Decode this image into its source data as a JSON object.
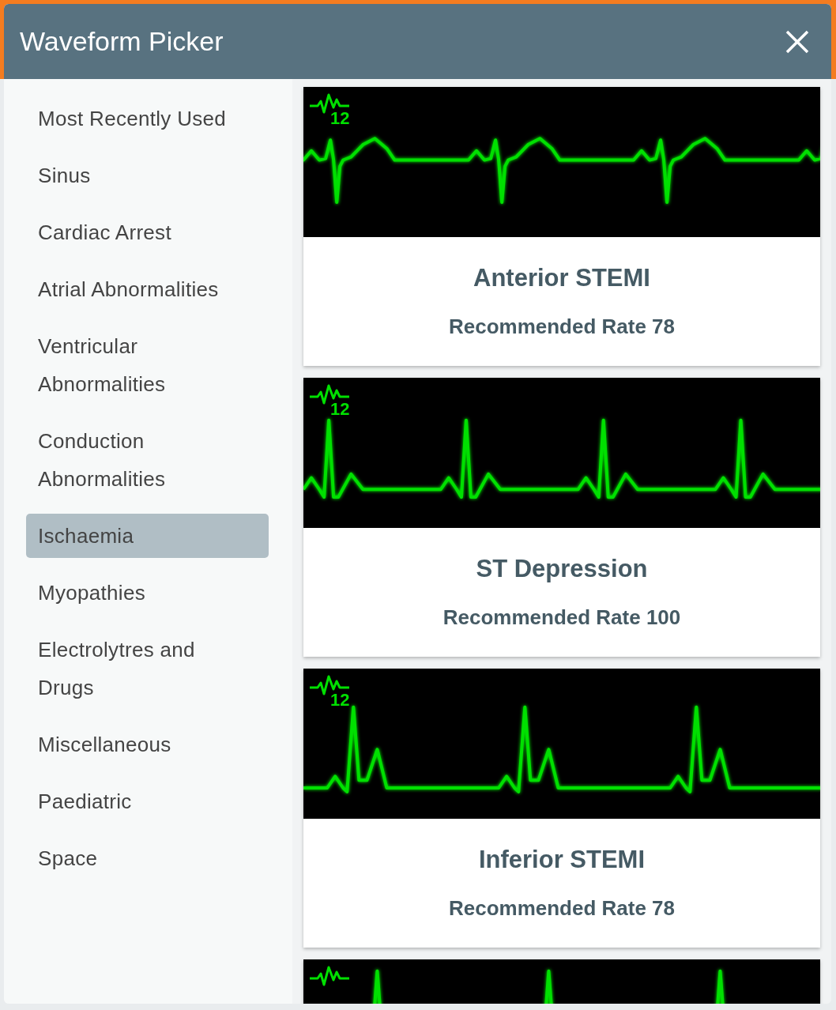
{
  "window": {
    "title": "Waveform Picker"
  },
  "sidebar": {
    "items": [
      {
        "label": "Most Recently Used",
        "selected": false
      },
      {
        "label": "Sinus",
        "selected": false
      },
      {
        "label": "Cardiac Arrest",
        "selected": false
      },
      {
        "label": "Atrial Abnormalities",
        "selected": false
      },
      {
        "label": "Ventricular Abnormalities",
        "selected": false
      },
      {
        "label": "Conduction Abnormalities",
        "selected": false
      },
      {
        "label": "Ischaemia",
        "selected": true
      },
      {
        "label": "Myopathies",
        "selected": false
      },
      {
        "label": "Electrolytres and Drugs",
        "selected": false
      },
      {
        "label": "Miscellaneous",
        "selected": false
      },
      {
        "label": "Paediatric",
        "selected": false
      },
      {
        "label": "Space",
        "selected": false
      }
    ]
  },
  "waveforms": [
    {
      "kind": "anterior",
      "lead_label": "12",
      "name": "Anterior STEMI",
      "rate": "Recommended Rate 78"
    },
    {
      "kind": "st_depression",
      "lead_label": "12",
      "name": "ST Depression",
      "rate": "Recommended Rate 100"
    },
    {
      "kind": "inferior",
      "lead_label": "12",
      "name": "Inferior STEMI",
      "rate": "Recommended Rate 78"
    },
    {
      "kind": "partial"
    }
  ]
}
